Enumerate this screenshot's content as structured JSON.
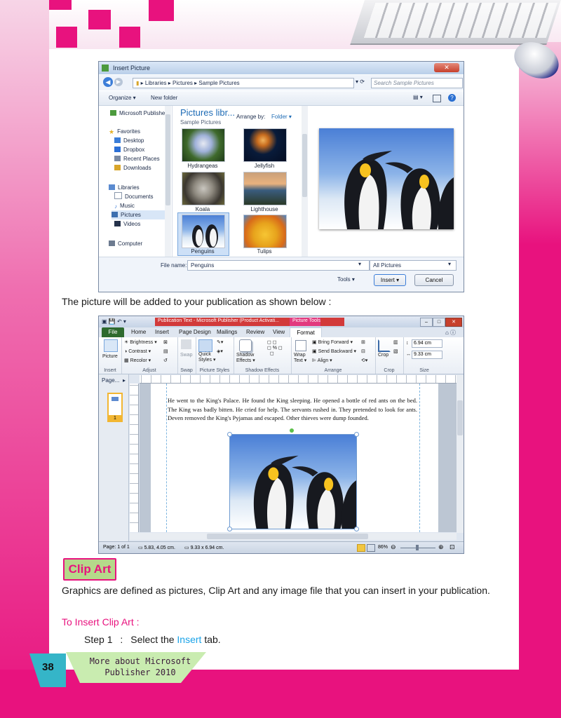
{
  "insert_dialog": {
    "title": "Insert Picture",
    "breadcrumb": [
      "Libraries",
      "Pictures",
      "Sample Pictures"
    ],
    "search_placeholder": "Search Sample Pictures",
    "toolbar": {
      "organize": "Organize ▾",
      "new_folder": "New folder"
    },
    "library_title": "Pictures libr...",
    "library_subtitle": "Sample Pictures",
    "arrange_label": "Arrange by:",
    "arrange_value": "Folder ▾",
    "nav": {
      "top": "Microsoft Publishe",
      "favorites": "Favorites",
      "favorites_items": [
        "Desktop",
        "Dropbox",
        "Recent Places",
        "Downloads"
      ],
      "libraries": "Libraries",
      "libraries_items": [
        "Documents",
        "Music",
        "Pictures",
        "Videos"
      ],
      "computer": "Computer"
    },
    "thumbnails": [
      "Hydrangeas",
      "Jellyfish",
      "Koala",
      "Lighthouse",
      "Penguins",
      "Tulips"
    ],
    "file_name_label": "File name:",
    "file_name_value": "Penguins",
    "filter_value": "All Pictures",
    "tools_label": "Tools",
    "insert_button": "Insert",
    "cancel_button": "Cancel"
  },
  "text_after_dialog": "The picture will be added to your publication as shown below :",
  "publisher_window": {
    "title": "Publication Text - Microsoft Publisher (Product Activati...",
    "picture_tools": "Picture Tools",
    "tabs": [
      "File",
      "Home",
      "Insert",
      "Page Design",
      "Mailings",
      "Review",
      "View",
      "Format"
    ],
    "groups": [
      "Insert",
      "Adjust",
      "Swap",
      "Picture Styles",
      "Shadow Effects",
      "Arrange",
      "Crop",
      "Size"
    ],
    "buttons": {
      "picture": "Picture",
      "brightness": "Brightness ▾",
      "contrast": "Contrast ▾",
      "recolor": "Recolor ▾",
      "swap": "Swap",
      "quick_styles": "Quick Styles ▾",
      "shadow_effects": "Shadow Effects ▾",
      "wrap_text": "Wrap Text ▾",
      "bring_forward": "Bring Forward ▾",
      "send_backward": "Send Backward ▾",
      "align": "Align ▾",
      "crop": "Crop",
      "height": "6.94 cm",
      "width": "9.33 cm"
    },
    "page_nav_label": "Page...",
    "page_number": "1",
    "doc_text": "He went to the King's Palace. He found the King sleeping. He opened a bottle of red ants on the bed. The King was badly bitten. He cried for help. The servants rushed in. They pretended to look for ants. Deven removed the King's Pyjamas and escaped. Other thieves were dump founded.",
    "status": {
      "page": "Page: 1 of 1",
      "position": "5.83, 4.05 cm.",
      "size": "9.33 x 6.94 cm.",
      "zoom": "86%"
    }
  },
  "clip_art": {
    "heading": "Clip Art",
    "paragraph": "Graphics are defined as pictures, Clip Art and any image file that you can insert in your publication.",
    "subheading": "To Insert Clip Art :",
    "step_label": "Step 1",
    "step_colon": ":",
    "step_text_pre": "Select the",
    "step_highlight": "Insert",
    "step_text_post": "tab."
  },
  "footer": {
    "page_number": "38",
    "book_title_line1": "More about Microsoft",
    "book_title_line2": "Publisher 2010"
  },
  "colors": {
    "magenta": "#e8127e",
    "cyan_highlight": "#1aa3e8",
    "heading_green": "#b5d98a",
    "footer_green": "#c9ecb0",
    "footer_cyan": "#35b5c8"
  }
}
